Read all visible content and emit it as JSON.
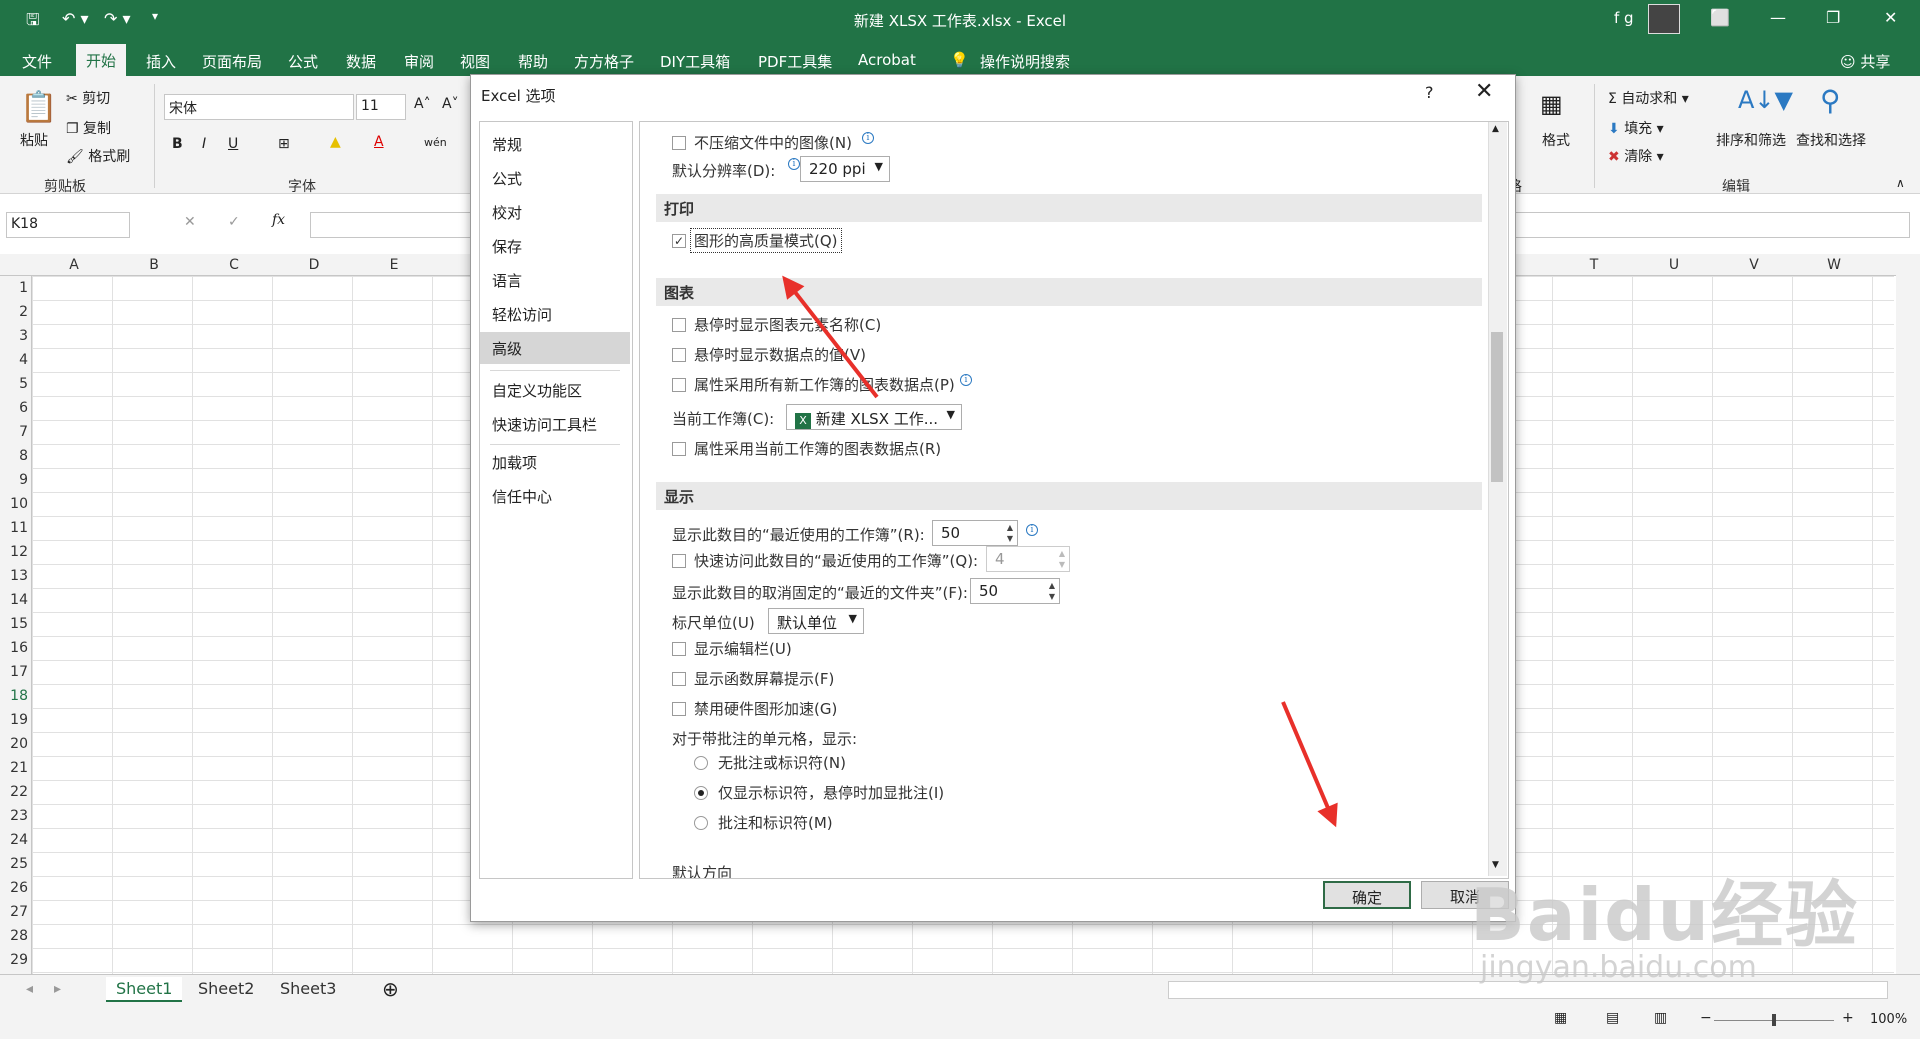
{
  "window": {
    "title": "新建 XLSX 工作表.xlsx  -  Excel",
    "user": "f g",
    "share": "共享"
  },
  "ribbon_tabs": [
    "文件",
    "开始",
    "插入",
    "页面布局",
    "公式",
    "数据",
    "审阅",
    "视图",
    "帮助",
    "方方格子",
    "DIY工具箱",
    "PDF工具集",
    "Acrobat",
    "操作说明搜索"
  ],
  "ribbon": {
    "paste": "粘贴",
    "cut": "剪切",
    "copy": "复制",
    "format_painter": "格式刷",
    "clipboard_group": "剪贴板",
    "font_name": "宋体",
    "font_size": "11",
    "font_group": "字体",
    "bold": "B",
    "italic": "I",
    "underline": "U",
    "phonetic": "wén",
    "autosum": "自动求和",
    "fill": "填充",
    "clear": "清除",
    "sort_filter": "排序和筛选",
    "find_select": "查找和选择",
    "editing_group": "编辑",
    "format": "格式",
    "cells_group_partial": "格"
  },
  "formula_bar": {
    "name_box": "K18",
    "fx": "fx"
  },
  "columns_left": [
    "A",
    "B",
    "C",
    "D",
    "E"
  ],
  "columns_right": [
    "T",
    "U",
    "V",
    "W"
  ],
  "rows": [
    "1",
    "2",
    "3",
    "4",
    "5",
    "6",
    "7",
    "8",
    "9",
    "10",
    "11",
    "12",
    "13",
    "14",
    "15",
    "16",
    "17",
    "18",
    "19",
    "20",
    "21",
    "22",
    "23",
    "24",
    "25",
    "26",
    "27",
    "28",
    "29"
  ],
  "sheets": [
    "Sheet1",
    "Sheet2",
    "Sheet3"
  ],
  "status": {
    "zoom": "100%"
  },
  "dialog": {
    "title": "Excel 选项",
    "help": "?",
    "nav": [
      "常规",
      "公式",
      "校对",
      "保存",
      "语言",
      "轻松访问",
      "高级",
      "自定义功能区",
      "快速访问工具栏",
      "加载项",
      "信任中心"
    ],
    "selected_nav": "高级",
    "options": {
      "no_compress": "不压缩文件中的图像(N)",
      "default_resolution_label": "默认分辨率(D):",
      "default_resolution_value": "220 ppi",
      "print_header": "打印",
      "high_quality": "图形的高质量模式(Q)",
      "chart_header": "图表",
      "hover_names": "悬停时显示图表元素名称(C)",
      "hover_values": "悬停时显示数据点的值(V)",
      "props_all": "属性采用所有新工作簿的图表数据点(P)",
      "current_wb_label": "当前工作簿(C):",
      "current_wb_value": "新建 XLSX 工作...",
      "props_current": "属性采用当前工作簿的图表数据点(R)",
      "display_header": "显示",
      "recent_workbooks_label": "显示此数目的“最近使用的工作簿”(R):",
      "recent_workbooks_value": "50",
      "quick_access_label": "快速访问此数目的“最近使用的工作簿”(Q):",
      "quick_access_value": "4",
      "unpinned_folders_label": "显示此数目的取消固定的“最近的文件夹”(F):",
      "unpinned_folders_value": "50",
      "ruler_units_label": "标尺单位(U)",
      "ruler_units_value": "默认单位",
      "show_formula_bar": "显示编辑栏(U)",
      "show_function_tips": "显示函数屏幕提示(F)",
      "disable_hw_accel": "禁用硬件图形加速(G)",
      "comments_label": "对于带批注的单元格，显示:",
      "no_comments": "无批注或标识符(N)",
      "indicators_only": "仅显示标识符，悬停时加显批注(I)",
      "comments_and_indicators": "批注和标识符(M)",
      "cut_off": "默认方向"
    },
    "ok": "确定",
    "cancel": "取消"
  },
  "watermark": {
    "brand": "Baidu经验",
    "url": "jingyan.baidu.com"
  },
  "colors": {
    "excel_green": "#217346",
    "arrow_red": "#e8302a"
  }
}
